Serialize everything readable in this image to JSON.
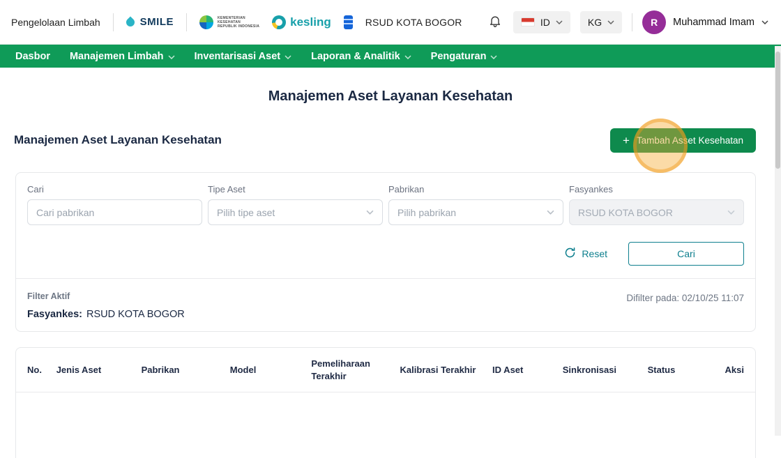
{
  "colors": {
    "nav_green": "#0f9b58",
    "button_green": "#0e8a4d",
    "teal": "#0e7f8e",
    "navy": "#1b2943",
    "highlight_orange": "#f5a733",
    "avatar_purple": "#952d98"
  },
  "header": {
    "app_title": "Pengelolaan Limbah",
    "smile_label": "SMILE",
    "kemenkes_lines": [
      "KEMENTERIAN",
      "KESEHATAN",
      "REPUBLIK INDONESIA"
    ],
    "kesling_label": "kesling",
    "org_name": "RSUD KOTA BOGOR",
    "language": "ID",
    "unit": "KG",
    "user_name": "Muhammad Imam",
    "avatar_initial": "R"
  },
  "nav": {
    "items": [
      {
        "label": "Dasbor",
        "dropdown": false
      },
      {
        "label": "Manajemen Limbah",
        "dropdown": true
      },
      {
        "label": "Inventarisasi Aset",
        "dropdown": true
      },
      {
        "label": "Laporan & Analitik",
        "dropdown": true
      },
      {
        "label": "Pengaturan",
        "dropdown": true
      }
    ]
  },
  "page": {
    "title": "Manajemen Aset Layanan Kesehatan",
    "section_title": "Manajemen Aset Layanan Kesehatan",
    "add_button_label": "Tambah Asset Kesehatan",
    "plus_glyph": "+"
  },
  "filters": {
    "search_label": "Cari",
    "search_placeholder": "Cari pabrikan",
    "type_label": "Tipe Aset",
    "type_placeholder": "Pilih tipe aset",
    "manufacturer_label": "Pabrikan",
    "manufacturer_placeholder": "Pilih pabrikan",
    "facility_label": "Fasyankes",
    "facility_value": "RSUD KOTA BOGOR",
    "reset_label": "Reset",
    "search_button_label": "Cari",
    "active_filter_title": "Filter Aktif",
    "active_filter_name": "Fasyankes:",
    "active_filter_value": "RSUD KOTA BOGOR",
    "filtered_at": "Difilter pada: 02/10/25 11:07"
  },
  "table": {
    "headers": [
      "No.",
      "Jenis Aset",
      "Pabrikan",
      "Model",
      "Pemeliharaan Terakhir",
      "Kalibrasi Terakhir",
      "ID Aset",
      "Sinkronisasi",
      "Status",
      "Aksi"
    ]
  }
}
